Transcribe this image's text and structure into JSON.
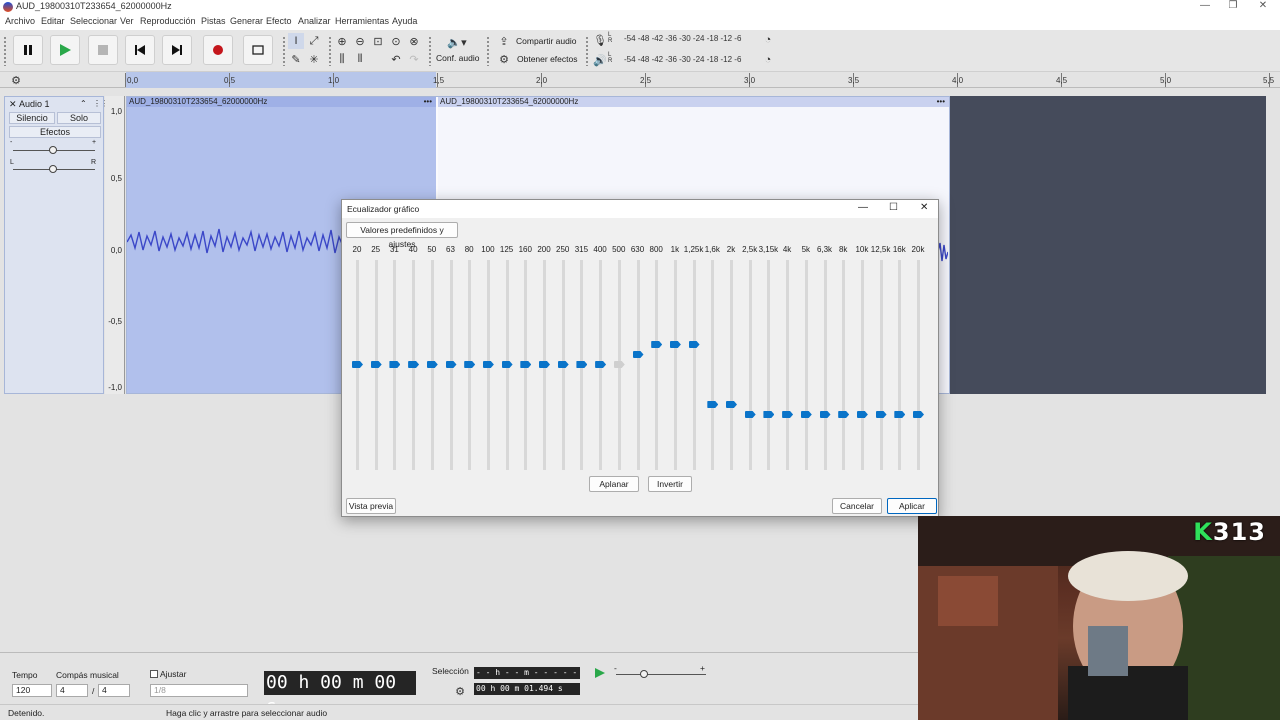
{
  "window": {
    "title": "AUD_19800310T233654_62000000Hz"
  },
  "menu": [
    "Archivo",
    "Editar",
    "Seleccionar",
    "Ver",
    "Reproducción",
    "Pistas",
    "Generar",
    "Efecto",
    "Analizar",
    "Herramientas",
    "Ayuda"
  ],
  "toolbar": {
    "conf_audio": "Conf. audio",
    "share_audio": "Compartir audio",
    "get_effects": "Obtener efectos",
    "meter_scale": "-54  -48  -42  -36  -30  -24  -18  -12  -6",
    "meter_scale_play": "-54  -48  -42  -36  -30  -24  -18  -12  -6",
    "meter_rec_channels": "L\nR",
    "meter_play_channels": "L\nR"
  },
  "ruler": {
    "ticks": [
      "0,0",
      "0,5",
      "1,0",
      "1,5",
      "2,0",
      "2,5",
      "3,0",
      "3,5",
      "4,0",
      "4,5",
      "5,0",
      "5,5"
    ]
  },
  "track": {
    "name": "Audio 1",
    "mute": "Silencio",
    "solo": "Solo",
    "effects": "Efectos",
    "gain_minus": "-",
    "gain_plus": "+",
    "pan_left": "L",
    "pan_right": "R",
    "clip1": "AUD_19800310T233654_62000000Hz",
    "clip2": "AUD_19800310T233654_62000000Hz",
    "clip_menu": "•••",
    "scale": [
      "1,0",
      "0,5",
      "0,0",
      "-0,5",
      "-1,0"
    ]
  },
  "dialog": {
    "title": "Ecualizador gráfico",
    "presets": "Valores predefinidos y ajustes",
    "bands": [
      "20",
      "25",
      "31",
      "40",
      "50",
      "63",
      "80",
      "100",
      "125",
      "160",
      "200",
      "250",
      "315",
      "400",
      "500",
      "630",
      "800",
      "1k",
      "1,25k",
      "1,6k",
      "2k",
      "2,5k",
      "3,15k",
      "4k",
      "5k",
      "6,3k",
      "8k",
      "10k",
      "12,5k",
      "16k",
      "20k"
    ],
    "gains_db": [
      0,
      0,
      0,
      0,
      0,
      0,
      0,
      0,
      0,
      0,
      0,
      0,
      0,
      0,
      0,
      2,
      4,
      4,
      4,
      -8,
      -8,
      -10,
      -10,
      -10,
      -10,
      -10,
      -10,
      -10,
      -10,
      -10,
      -10
    ],
    "flatten": "Aplanar",
    "invert": "Invertir",
    "preview": "Vista previa",
    "cancel": "Cancelar",
    "apply": "Aplicar"
  },
  "bottom": {
    "tempo_label": "Tempo",
    "tempo_value": "120",
    "meter_label": "Compás musical",
    "meter_num": "4",
    "meter_slash": "/",
    "meter_den": "4",
    "snap_label": "Ajustar",
    "snap_value": "1/8",
    "time_display": "00 h 00 m 00 s",
    "selection_label": "Selección",
    "sel_start": "- - h - - m - - - - - - s",
    "sel_end": "00 h 00 m 01.494 s",
    "playspeed_minus": "-",
    "playspeed_plus": "+"
  },
  "status": {
    "left": "Detenido.",
    "hint": "Haga clic y arrastre para seleccionar audio"
  },
  "webcam": {
    "badge_k": "K",
    "badge_num": "313"
  }
}
